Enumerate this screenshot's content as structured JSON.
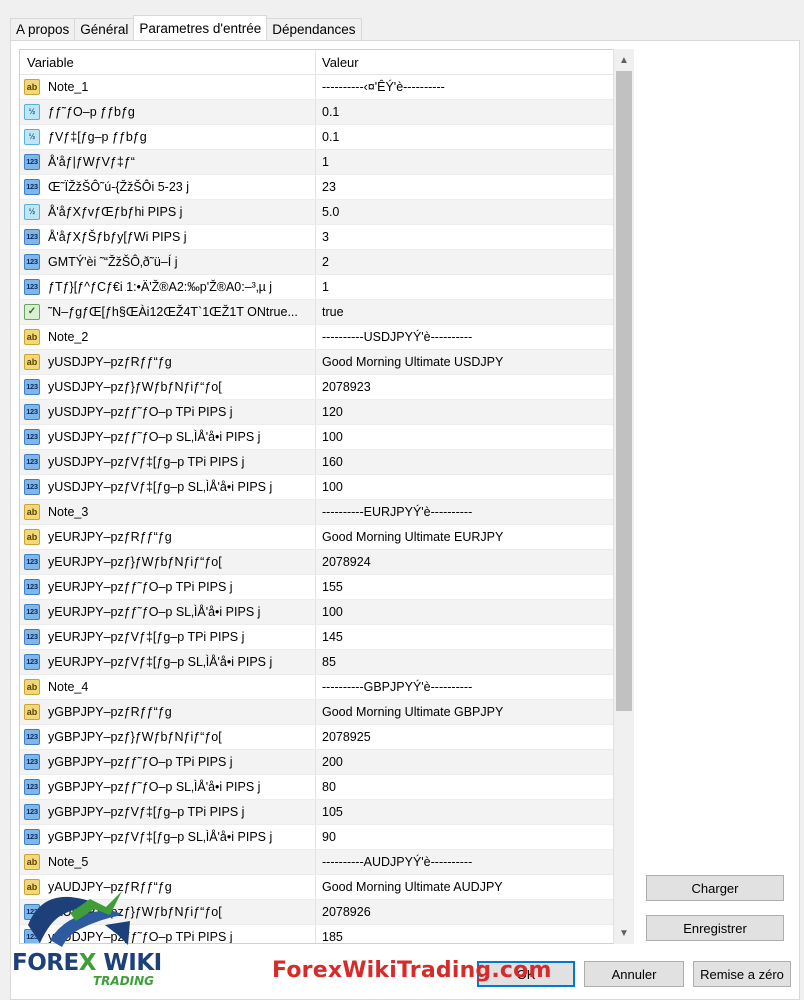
{
  "tabs": [
    "A propos",
    "Général",
    "Parametres d'entrée",
    "Dépendances"
  ],
  "grid": {
    "headers": {
      "variable": "Variable",
      "value": "Valeur"
    },
    "rows": [
      {
        "icon": "ab",
        "name": "Note_1",
        "value": "----------‹¤'ÊÝ'è----------"
      },
      {
        "icon": "half",
        "name": "ƒƒ˜ƒO–p ƒƒbƒg",
        "value": "0.1"
      },
      {
        "icon": "half",
        "name": "ƒVƒ‡[ƒg–p ƒƒbƒg",
        "value": "0.1"
      },
      {
        "icon": "num",
        "name": "Å'åƒ|ƒWƒVƒ‡ƒ“",
        "value": "1"
      },
      {
        "icon": "num",
        "name": "Œ˜ÏŽžŠÔ˜ú-{ŽžŠÔi 5-23 j",
        "value": "23"
      },
      {
        "icon": "half",
        "name": "Å'åƒXƒvƒŒƒbƒhi PIPS j",
        "value": "5.0"
      },
      {
        "icon": "num",
        "name": "Å'åƒXƒŠƒbƒy[ƒWi PIPS j",
        "value": "3"
      },
      {
        "icon": "num",
        "name": "GMTÝ'èi ˜“ŽžŠÔ‚ð˜ü–Í j",
        "value": "2"
      },
      {
        "icon": "num",
        "name": "ƒTƒ}[ƒ^ƒCƒ€i 1:•Ä'Ž®A2:‰p'Ž®A0:–³‚µ j",
        "value": "1"
      },
      {
        "icon": "bool",
        "name": "˜N–ƒgƒŒ[ƒh§ŒÀi12ŒŽ4T`1ŒŽ1T ONtrue...",
        "value": "true"
      },
      {
        "icon": "ab",
        "name": "Note_2",
        "value": "----------USDJPYÝ'è----------"
      },
      {
        "icon": "ab",
        "name": "yUSDJPY–pzƒRƒƒ“ƒg",
        "value": "Good Morning Ultimate USDJPY"
      },
      {
        "icon": "num",
        "name": "yUSDJPY–pzƒ}ƒWƒbƒNƒiƒ“ƒo[",
        "value": "2078923"
      },
      {
        "icon": "num",
        "name": "yUSDJPY–pzƒƒ˜ƒO–p TPi PIPS j",
        "value": "120"
      },
      {
        "icon": "num",
        "name": "yUSDJPY–pzƒƒ˜ƒO–p SL‚ÌÅ'å•i PIPS j",
        "value": "100"
      },
      {
        "icon": "num",
        "name": "yUSDJPY–pzƒVƒ‡[ƒg–p TPi PIPS j",
        "value": "160"
      },
      {
        "icon": "num",
        "name": "yUSDJPY–pzƒVƒ‡[ƒg–p SL‚ÌÅ'å•i PIPS j",
        "value": "100"
      },
      {
        "icon": "ab",
        "name": "Note_3",
        "value": "----------EURJPYÝ'è----------"
      },
      {
        "icon": "ab",
        "name": "yEURJPY–pzƒRƒƒ“ƒg",
        "value": "Good Morning Ultimate EURJPY"
      },
      {
        "icon": "num",
        "name": "yEURJPY–pzƒ}ƒWƒbƒNƒiƒ“ƒo[",
        "value": "2078924"
      },
      {
        "icon": "num",
        "name": "yEURJPY–pzƒƒ˜ƒO–p TPi PIPS j",
        "value": "155"
      },
      {
        "icon": "num",
        "name": "yEURJPY–pzƒƒ˜ƒO–p SL‚ÌÅ'å•i PIPS j",
        "value": "100"
      },
      {
        "icon": "num",
        "name": "yEURJPY–pzƒVƒ‡[ƒg–p TPi PIPS j",
        "value": "145"
      },
      {
        "icon": "num",
        "name": "yEURJPY–pzƒVƒ‡[ƒg–p SL‚ÌÅ'å•i PIPS j",
        "value": "85"
      },
      {
        "icon": "ab",
        "name": "Note_4",
        "value": "----------GBPJPYÝ'è----------"
      },
      {
        "icon": "ab",
        "name": "yGBPJPY–pzƒRƒƒ“ƒg",
        "value": "Good Morning Ultimate GBPJPY"
      },
      {
        "icon": "num",
        "name": "yGBPJPY–pzƒ}ƒWƒbƒNƒiƒ“ƒo[",
        "value": "2078925"
      },
      {
        "icon": "num",
        "name": "yGBPJPY–pzƒƒ˜ƒO–p TPi PIPS j",
        "value": "200"
      },
      {
        "icon": "num",
        "name": "yGBPJPY–pzƒƒ˜ƒO–p SL‚ÌÅ'å•i PIPS j",
        "value": "80"
      },
      {
        "icon": "num",
        "name": "yGBPJPY–pzƒVƒ‡[ƒg–p TPi PIPS j",
        "value": "105"
      },
      {
        "icon": "num",
        "name": "yGBPJPY–pzƒVƒ‡[ƒg–p SL‚ÌÅ'å•i PIPS j",
        "value": "90"
      },
      {
        "icon": "ab",
        "name": "Note_5",
        "value": "----------AUDJPYÝ'è----------"
      },
      {
        "icon": "ab",
        "name": "yAUDJPY–pzƒRƒƒ“ƒg",
        "value": "Good Morning Ultimate AUDJPY"
      },
      {
        "icon": "num",
        "name": "yAUDJPY–pzƒ}ƒWƒbƒNƒiƒ“ƒo[",
        "value": "2078926"
      },
      {
        "icon": "num",
        "name": "yAUDJPY–pzƒƒ˜ƒO–p TPi PIPS j",
        "value": "185"
      }
    ]
  },
  "icon_labels": {
    "ab": "ab",
    "half": "½",
    "num": "123",
    "bool": "✓"
  },
  "buttons": {
    "charger": "Charger",
    "enregistrer": "Enregistrer",
    "ok": "OK",
    "annuler": "Annuler",
    "reset": "Remise a zéro"
  },
  "watermark": "ForexWikiTrading.com",
  "logo": {
    "part1": "FORE",
    "x": "X",
    "part2": " WIKI",
    "sub": "TRADING"
  }
}
